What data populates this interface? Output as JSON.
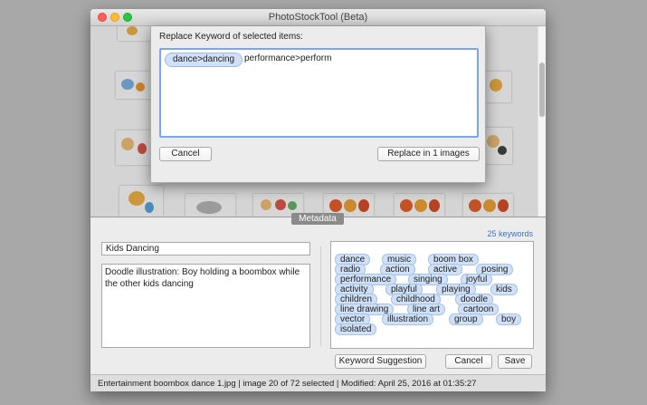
{
  "window": {
    "title": "PhotoStockTool (Beta)"
  },
  "replace_dialog": {
    "label": "Replace Keyword of selected items:",
    "tokens": [
      "dance>dancing",
      "performance>perform"
    ],
    "cancel_label": "Cancel",
    "replace_label": "Replace in 1 images"
  },
  "metadata": {
    "tab_label": "Metadata",
    "keyword_count": "25 keywords",
    "title_value": "Kids Dancing",
    "description_value": "Doodle illustration: Boy holding a boombox while the other kids dancing",
    "keywords": [
      "dance",
      "music",
      "boom box",
      "radio",
      "action",
      "active",
      "posing",
      "performance",
      "singing",
      "joyful",
      "activity",
      "playful",
      "playing",
      "kids",
      "children",
      "childhood",
      "doodle",
      "line drawing",
      "line art",
      "cartoon",
      "vector",
      "illustration",
      "group",
      "boy",
      "isolated"
    ],
    "keyword_suggestion_label": "Keyword Suggestion",
    "cancel_label": "Cancel",
    "save_label": "Save"
  },
  "status": {
    "text": "Entertainment boombox dance 1.jpg | image 20 of 72 selected | Modified: April 25, 2016 at 01:35:27"
  },
  "colors": {
    "token_fill": "#cfe0f7",
    "focus_ring": "#7aa7e8",
    "keyword_count_text": "#3b73c8"
  }
}
